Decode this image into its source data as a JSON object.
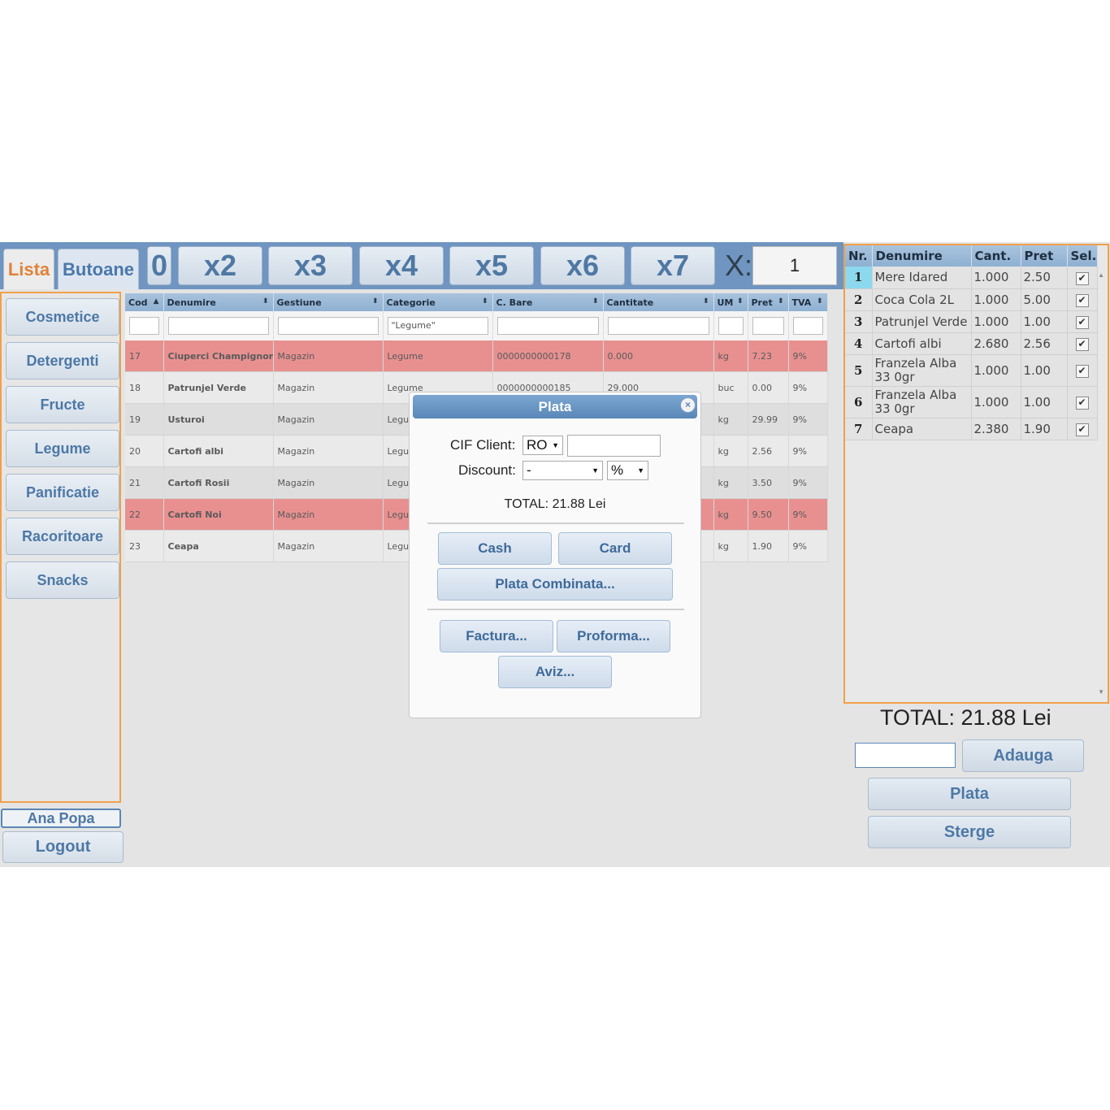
{
  "tabs": {
    "lista": "Lista",
    "butoane": "Butoane"
  },
  "multipliers": [
    "0",
    "x2",
    "x3",
    "x4",
    "x5",
    "x6",
    "x7"
  ],
  "quantity": {
    "label": "X:",
    "value": "1"
  },
  "categories": [
    "Cosmetice",
    "Detergenti",
    "Fructe",
    "Legume",
    "Panificatie",
    "Racoritoare",
    "Snacks"
  ],
  "user": {
    "name": "Ana Popa",
    "logout": "Logout"
  },
  "grid": {
    "columns": [
      "Cod",
      "Denumire",
      "Gestiune",
      "Categorie",
      "C. Bare",
      "Cantitate",
      "UM",
      "Pret",
      "TVA"
    ],
    "filter_categorie": "\"Legume\"",
    "rows": [
      [
        "17",
        "Ciuperci Champignon",
        "Magazin",
        "Legume",
        "0000000000178",
        "0.000",
        "kg",
        "7.23",
        "9%"
      ],
      [
        "18",
        "Patrunjel Verde",
        "Magazin",
        "Legume",
        "0000000000185",
        "29.000",
        "buc",
        "0.00",
        "9%"
      ],
      [
        "19",
        "Usturoi",
        "Magazin",
        "Legu",
        "",
        "",
        "kg",
        "29.99",
        "9%"
      ],
      [
        "20",
        "Cartofi albi",
        "Magazin",
        "Legu",
        "",
        "",
        "kg",
        "2.56",
        "9%"
      ],
      [
        "21",
        "Cartofi Rosii",
        "Magazin",
        "Legu",
        "",
        "",
        "kg",
        "3.50",
        "9%"
      ],
      [
        "22",
        "Cartofi Noi",
        "Magazin",
        "Legu",
        "",
        "",
        "kg",
        "9.50",
        "9%"
      ],
      [
        "23",
        "Ceapa",
        "Magazin",
        "Legu",
        "",
        "",
        "kg",
        "1.90",
        "9%"
      ]
    ]
  },
  "cart": {
    "columns": [
      "Nr.",
      "Denumire",
      "Cant.",
      "Pret",
      "Sel."
    ],
    "rows": [
      [
        "1",
        "Mere Idared",
        "1.000",
        "2.50"
      ],
      [
        "2",
        "Coca Cola 2L",
        "1.000",
        "5.00"
      ],
      [
        "3",
        "Patrunjel Verde",
        "1.000",
        "1.00"
      ],
      [
        "4",
        "Cartofi albi",
        "2.680",
        "2.56"
      ],
      [
        "5",
        "Franzela Alba 33 0gr",
        "1.000",
        "1.00"
      ],
      [
        "6",
        "Franzela Alba 33 0gr",
        "1.000",
        "1.00"
      ],
      [
        "7",
        "Ceapa",
        "2.380",
        "1.90"
      ]
    ],
    "check_glyph": "✔"
  },
  "total_text": "TOTAL: 21.88 Lei",
  "actions": {
    "adauga": "Adauga",
    "plata": "Plata",
    "sterge": "Sterge"
  },
  "modal": {
    "title": "Plata",
    "cif_label": "CIF Client:",
    "cif_prefix": "RO",
    "discount_label": "Discount:",
    "discount_value": "-",
    "discount_unit": "%",
    "total": "TOTAL: 21.88 Lei",
    "cash": "Cash",
    "card": "Card",
    "combinata": "Plata Combinata...",
    "factura": "Factura...",
    "proforma": "Proforma...",
    "aviz": "Aviz..."
  },
  "colors": {
    "accent_orange": "#f0a04b",
    "header_blue": "#6f95c0",
    "row_red": "#e89090",
    "button_text": "#4d78a6"
  }
}
